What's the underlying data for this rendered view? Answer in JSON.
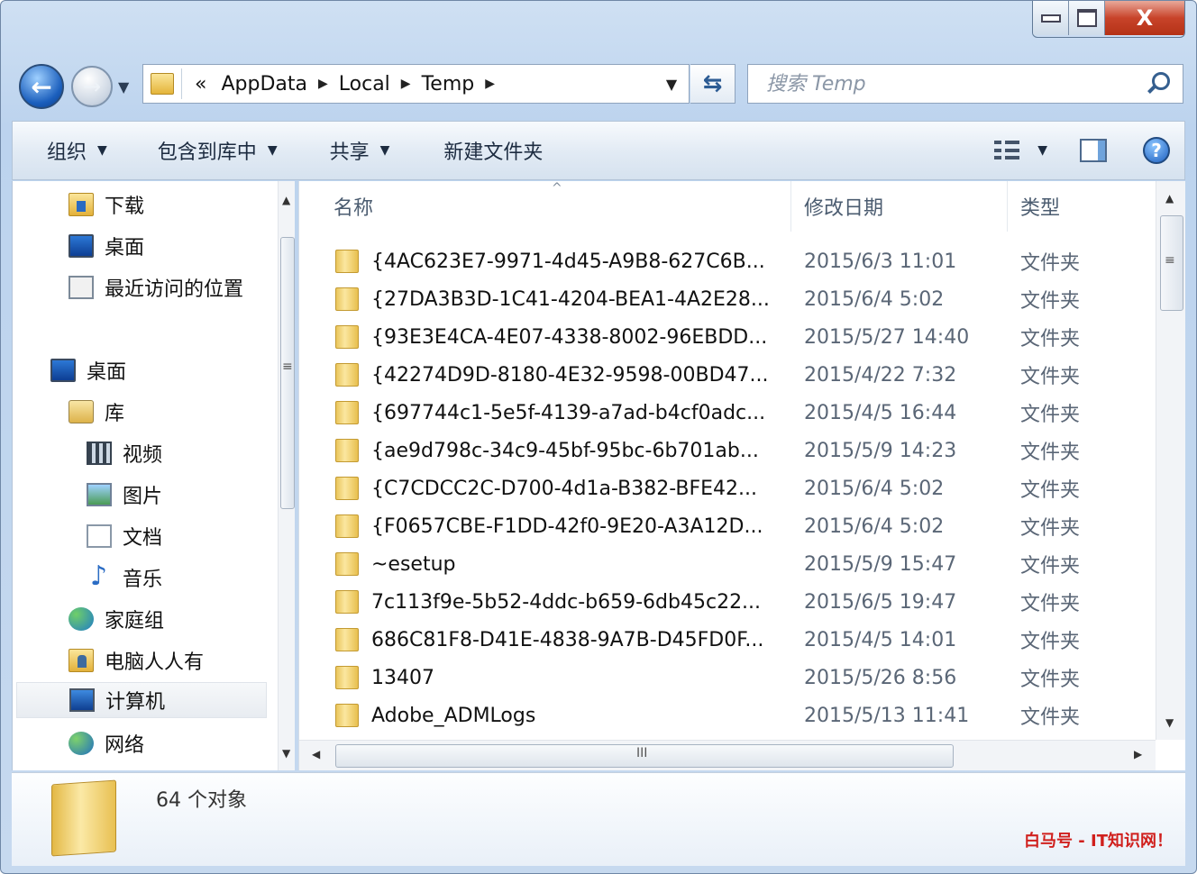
{
  "window": {
    "caption": {
      "minimize": "",
      "maximize": "",
      "close": "X"
    }
  },
  "address": {
    "prefix": "«",
    "crumbs": [
      "AppData",
      "Local",
      "Temp"
    ]
  },
  "search": {
    "placeholder": "搜索 Temp"
  },
  "toolbar": {
    "organize": "组织",
    "include_in_library": "包含到库中",
    "share": "共享",
    "new_folder": "新建文件夹"
  },
  "nav": {
    "items": [
      {
        "label": "下载",
        "icon": "download-folder-icon"
      },
      {
        "label": "桌面",
        "icon": "desktop-icon"
      },
      {
        "label": "最近访问的位置",
        "icon": "recent-places-icon"
      },
      {
        "label": "桌面",
        "icon": "desktop-icon"
      },
      {
        "label": "库",
        "icon": "library-icon"
      },
      {
        "label": "视频",
        "icon": "video-icon"
      },
      {
        "label": "图片",
        "icon": "pictures-icon"
      },
      {
        "label": "文档",
        "icon": "documents-icon"
      },
      {
        "label": "音乐",
        "icon": "music-icon"
      },
      {
        "label": "家庭组",
        "icon": "homegroup-icon"
      },
      {
        "label": "电脑人人有",
        "icon": "user-folder-icon"
      },
      {
        "label": "计算机",
        "icon": "computer-icon",
        "selected": true
      },
      {
        "label": "网络",
        "icon": "network-icon"
      }
    ]
  },
  "columns": {
    "name": "名称",
    "date": "修改日期",
    "type": "类型"
  },
  "files": [
    {
      "name": "{4AC623E7-9971-4d45-A9B8-627C6B...",
      "date": "2015/6/3 11:01",
      "type": "文件夹"
    },
    {
      "name": "{27DA3B3D-1C41-4204-BEA1-4A2E28...",
      "date": "2015/6/4 5:02",
      "type": "文件夹"
    },
    {
      "name": "{93E3E4CA-4E07-4338-8002-96EBDD...",
      "date": "2015/5/27 14:40",
      "type": "文件夹"
    },
    {
      "name": "{42274D9D-8180-4E32-9598-00BD47...",
      "date": "2015/4/22 7:32",
      "type": "文件夹"
    },
    {
      "name": "{697744c1-5e5f-4139-a7ad-b4cf0adc...",
      "date": "2015/4/5 16:44",
      "type": "文件夹"
    },
    {
      "name": "{ae9d798c-34c9-45bf-95bc-6b701ab...",
      "date": "2015/5/9 14:23",
      "type": "文件夹"
    },
    {
      "name": "{C7CDCC2C-D700-4d1a-B382-BFE42...",
      "date": "2015/6/4 5:02",
      "type": "文件夹"
    },
    {
      "name": "{F0657CBE-F1DD-42f0-9E20-A3A12D...",
      "date": "2015/6/4 5:02",
      "type": "文件夹"
    },
    {
      "name": "~esetup",
      "date": "2015/5/9 15:47",
      "type": "文件夹"
    },
    {
      "name": "7c113f9e-5b52-4ddc-b659-6db45c22...",
      "date": "2015/6/5 19:47",
      "type": "文件夹"
    },
    {
      "name": "686C81F8-D41E-4838-9A7B-D45FD0F...",
      "date": "2015/4/5 14:01",
      "type": "文件夹"
    },
    {
      "name": "13407",
      "date": "2015/5/26 8:56",
      "type": "文件夹"
    },
    {
      "name": "Adobe_ADMLogs",
      "date": "2015/5/13 11:41",
      "type": "文件夹"
    }
  ],
  "status": {
    "object_count": "64 个对象"
  },
  "watermark": "白马号 - IT知识网！"
}
